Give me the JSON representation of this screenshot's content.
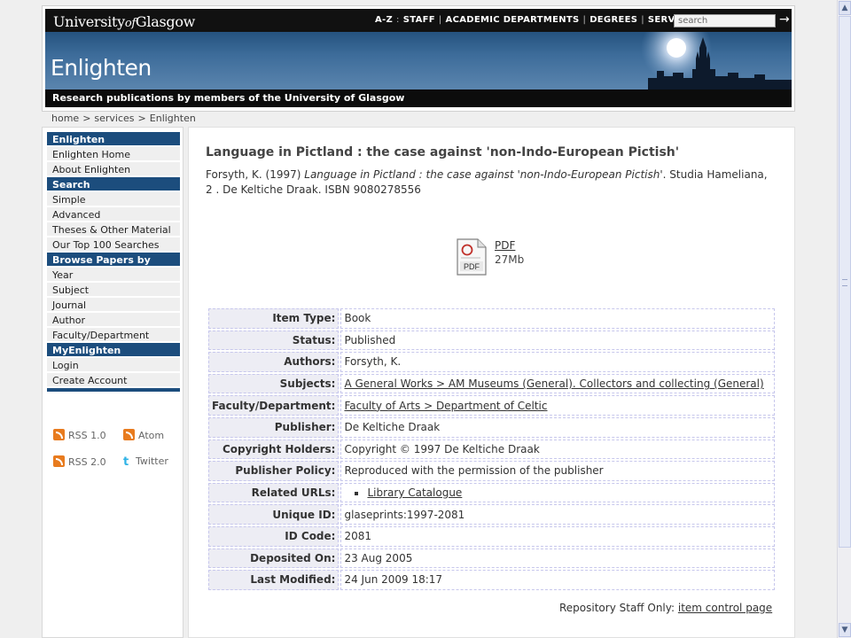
{
  "header": {
    "logo_main": "University",
    "logo_of": "of",
    "logo_end": "Glasgow",
    "nav": [
      "A-Z",
      ":",
      "STAFF",
      "|",
      "ACADEMIC DEPARTMENTS",
      "|",
      "DEGREES",
      "|",
      "SERVICES",
      "|"
    ],
    "search_placeholder": "search",
    "banner_title": "Enlighten",
    "tagline": "Research publications by members of the University of Glasgow"
  },
  "breadcrumb": [
    "home",
    ">",
    "services",
    ">",
    "Enlighten"
  ],
  "sidebar": {
    "groups": [
      {
        "heading": "Enlighten",
        "items": [
          "Enlighten Home",
          "About Enlighten"
        ]
      },
      {
        "heading": "Search",
        "items": [
          "Simple",
          "Advanced",
          "Theses & Other Material",
          "Our Top 100 Searches"
        ]
      },
      {
        "heading": "Browse Papers by",
        "items": [
          "Year",
          "Subject",
          "Journal",
          "Author",
          "Faculty/Department"
        ]
      },
      {
        "heading": "MyEnlighten",
        "items": [
          "Login",
          "Create Account"
        ]
      }
    ],
    "feeds": {
      "rss1": "RSS 1.0",
      "atom": "Atom",
      "rss2": "RSS 2.0",
      "twitter": "Twitter"
    }
  },
  "item": {
    "title": "Language in Pictland : the case against 'non-Indo-European Pictish'",
    "citation_prefix": "Forsyth, K. (1997) ",
    "citation_title": "Language in Pictland : the case against 'non-Indo-European Pictish'",
    "citation_rest": ". Studia Hameliana, 2 . De Keltiche Draak. ISBN 9080278556",
    "pdf_label": "PDF",
    "pdf_size": "27Mb",
    "pdf_icon_text": "PDF"
  },
  "meta": [
    {
      "key": "Item Type:",
      "value": "Book",
      "link": false
    },
    {
      "key": "Status:",
      "value": "Published",
      "link": false
    },
    {
      "key": "Authors:",
      "value": "Forsyth, K.",
      "link": false
    },
    {
      "key": "Subjects:",
      "value": "A General Works > AM Museums (General). Collectors and collecting (General)",
      "link": true
    },
    {
      "key": "Faculty/Department:",
      "value": "Faculty of Arts > Department of Celtic",
      "link": true
    },
    {
      "key": "Publisher:",
      "value": "De Keltiche Draak",
      "link": false
    },
    {
      "key": "Copyright Holders:",
      "value": "Copyright © 1997 De Keltiche Draak",
      "link": false
    },
    {
      "key": "Publisher Policy:",
      "value": "Reproduced with the permission of the publisher",
      "link": false
    },
    {
      "key": "Related URLs:",
      "value": "Library Catalogue",
      "link": true,
      "list": true
    },
    {
      "key": "Unique ID:",
      "value": "glaseprints:1997-2081",
      "link": false
    },
    {
      "key": "ID Code:",
      "value": "2081",
      "link": false
    },
    {
      "key": "Deposited On:",
      "value": "23 Aug 2005",
      "link": false
    },
    {
      "key": "Last Modified:",
      "value": "24 Jun 2009 18:17",
      "link": false
    }
  ],
  "staff": {
    "prefix": "Repository Staff Only: ",
    "link": "item control page"
  },
  "colors": {
    "nav_blue": "#1c4d7d",
    "header_black": "#111111",
    "banner_blue": "#3d6c9a"
  }
}
